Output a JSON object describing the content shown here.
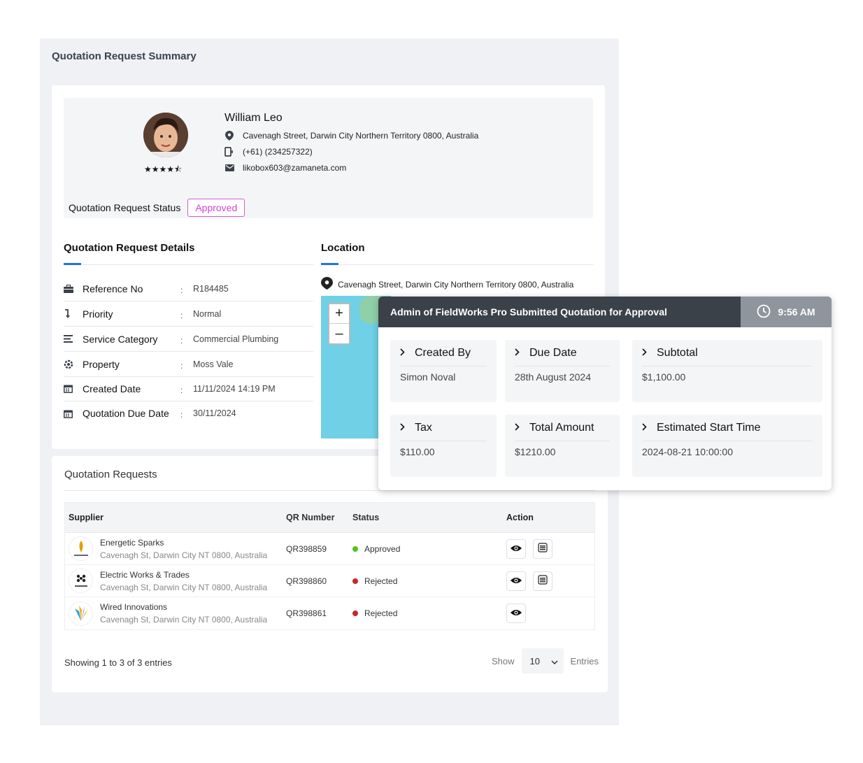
{
  "page": {
    "title": "Quotation Request Summary"
  },
  "profile": {
    "name": "William Leo",
    "rating_stars": "★★★★⯪",
    "address": "Cavenagh Street, Darwin City Northern Territory 0800, Australia",
    "phone": "(+61) (234257322)",
    "email": "likobox603@zamaneta.com",
    "status_label": "Quotation Request Status",
    "status_value": "Approved"
  },
  "details": {
    "title": "Quotation Request Details",
    "rows": [
      {
        "icon": "briefcase-icon",
        "label": "Reference No",
        "colon": ":",
        "value": "R184485"
      },
      {
        "icon": "priority-icon",
        "label": "Priority",
        "colon": ":",
        "value": "Normal"
      },
      {
        "icon": "list-icon",
        "label": "Service Category",
        "colon": ":",
        "value": "Commercial Plumbing"
      },
      {
        "icon": "property-icon",
        "label": "Property",
        "colon": ":",
        "value": "Moss Vale"
      },
      {
        "icon": "calendar-icon",
        "label": "Created Date",
        "colon": ":",
        "value": "11/11/2024 14:19 PM"
      },
      {
        "icon": "calendar-icon",
        "label": "Quotation Due Date",
        "colon": ":",
        "value": "30/11/2024"
      }
    ]
  },
  "location": {
    "title": "Location",
    "address": "Cavenagh Street, Darwin City Northern Territory 0800, Australia",
    "zoom_in": "+",
    "zoom_out": "–"
  },
  "requests": {
    "title": "Quotation Requests",
    "columns": {
      "supplier": "Supplier",
      "qr": "QR Number",
      "status": "Status",
      "action": "Action"
    },
    "rows": [
      {
        "name": "Energetic Sparks",
        "address": "Cavenagh St, Darwin City NT 0800, Australia",
        "qr": "QR398859",
        "status": "Approved",
        "status_color": "#52c41a"
      },
      {
        "name": "Electric Works & Trades",
        "address": "Cavenagh St, Darwin City NT 0800, Australia",
        "qr": "QR398860",
        "status": "Rejected",
        "status_color": "#c62828"
      },
      {
        "name": "Wired Innovations",
        "address": "Cavenagh St, Darwin City NT 0800, Australia",
        "qr": "QR398861",
        "status": "Rejected",
        "status_color": "#c62828"
      }
    ],
    "footer": {
      "showing": "Showing 1 to 3 of 3 entries",
      "show_label": "Show",
      "page_size": "10",
      "entries_label": "Entries"
    }
  },
  "popup": {
    "title": "Admin of FieldWorks Pro Submitted Quotation for Approval",
    "time": "9:56 AM",
    "tiles": [
      {
        "label": "Created By",
        "value": "Simon Noval"
      },
      {
        "label": "Due Date",
        "value": "28th August 2024"
      },
      {
        "label": "Subtotal",
        "value": "$1,100.00"
      },
      {
        "label": "Tax",
        "value": "$110.00"
      },
      {
        "label": "Total Amount",
        "value": "$1210.00"
      },
      {
        "label": "Estimated Start Time",
        "value": "2024-08-21 10:00:00"
      }
    ]
  },
  "colors": {
    "accent": "#1e73e8",
    "approved_badge": "#d245cd",
    "popup_header": "#3b4149"
  }
}
